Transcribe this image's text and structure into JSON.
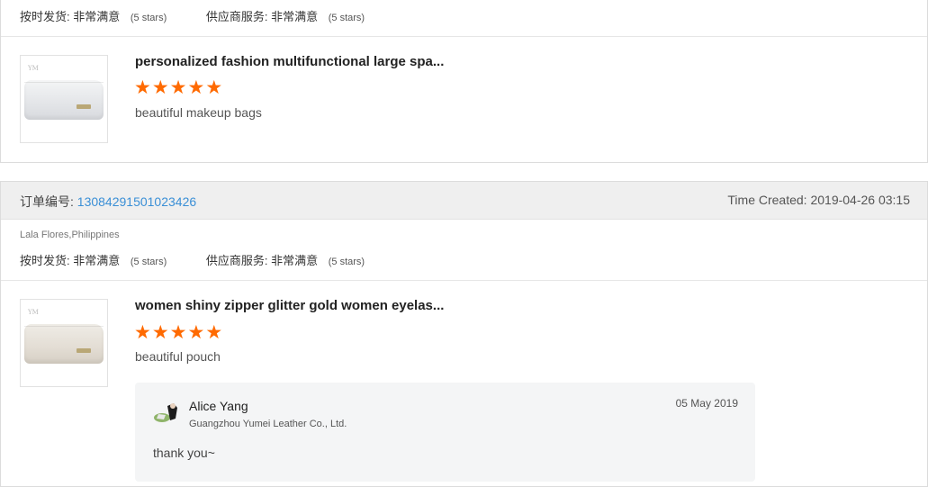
{
  "orders": [
    {
      "ratings": {
        "delivery_label": "按时发货:",
        "delivery_value": "非常满意",
        "delivery_stars": "(5 stars)",
        "service_label": "供应商服务:",
        "service_value": "非常满意",
        "service_stars": "(5 stars)"
      },
      "product": {
        "title": "personalized fashion multifunctional large spa...",
        "rating": 5,
        "review": "beautiful makeup bags",
        "thumb_logo": "YM"
      }
    },
    {
      "order_label": "订单编号:",
      "order_number": "13084291501023426",
      "time_created": "Time Created: 2019-04-26 03:15",
      "buyer": "Lala Flores,Philippines",
      "ratings": {
        "delivery_label": "按时发货:",
        "delivery_value": "非常满意",
        "delivery_stars": "(5 stars)",
        "service_label": "供应商服务:",
        "service_value": "非常满意",
        "service_stars": "(5 stars)"
      },
      "product": {
        "title": "women shiny zipper glitter gold women eyelas...",
        "rating": 5,
        "review": "beautiful pouch",
        "thumb_logo": "YM"
      },
      "reply": {
        "name": "Alice Yang",
        "company": "Guangzhou Yumei Leather Co., Ltd.",
        "date": "05 May 2019",
        "message": "thank you~"
      }
    }
  ],
  "colors": {
    "star": "#ff6a00",
    "link": "#3a8fd6",
    "header_bg": "#efefef"
  }
}
